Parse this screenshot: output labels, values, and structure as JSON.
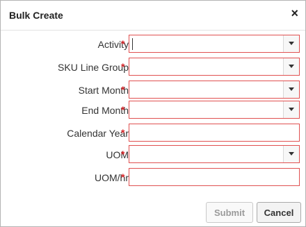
{
  "dialog": {
    "title": "Bulk Create",
    "close_symbol": "×"
  },
  "form": {
    "required_marker": "*",
    "fields": [
      {
        "label": "Activity",
        "type": "select",
        "value": ""
      },
      {
        "label": "SKU Line Group",
        "type": "select",
        "value": ""
      },
      {
        "label": "Start Month",
        "type": "select",
        "value": ""
      },
      {
        "label": "End Month",
        "type": "select",
        "value": ""
      },
      {
        "label": "Calendar Year",
        "type": "text",
        "value": ""
      },
      {
        "label": "UOM",
        "type": "select",
        "value": ""
      },
      {
        "label": "UOM/hr",
        "type": "text",
        "value": ""
      }
    ]
  },
  "buttons": {
    "submit": "Submit",
    "cancel": "Cancel"
  },
  "colors": {
    "required": "#d9262a",
    "error_border": "#e05050"
  },
  "icons": {
    "close": "close-icon",
    "dropdown": "chevron-down-icon"
  }
}
